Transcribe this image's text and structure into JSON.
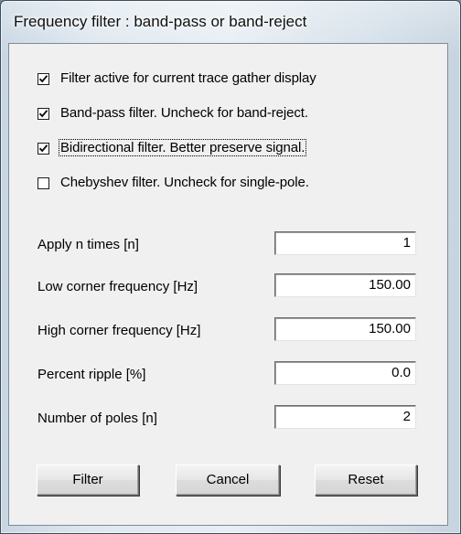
{
  "window": {
    "title": "Frequency filter : band-pass or band-reject"
  },
  "checkboxes": [
    {
      "label": "Filter active for current trace gather display",
      "checked": true
    },
    {
      "label": "Band-pass filter. Uncheck for band-reject.",
      "checked": true
    },
    {
      "label": "Bidirectional filter. Better preserve signal.",
      "checked": true
    },
    {
      "label": "Chebyshev filter. Uncheck for single-pole.",
      "checked": false
    }
  ],
  "fields": [
    {
      "label": "Apply n times [n]",
      "value": "1"
    },
    {
      "label": "Low corner frequency [Hz]",
      "value": "150.00"
    },
    {
      "label": "High corner frequency [Hz]",
      "value": "150.00"
    },
    {
      "label": "Percent ripple [%]",
      "value": "0.0"
    },
    {
      "label": "Number of poles [n]",
      "value": "2"
    }
  ],
  "buttons": {
    "filter": "Filter",
    "cancel": "Cancel",
    "reset": "Reset"
  }
}
